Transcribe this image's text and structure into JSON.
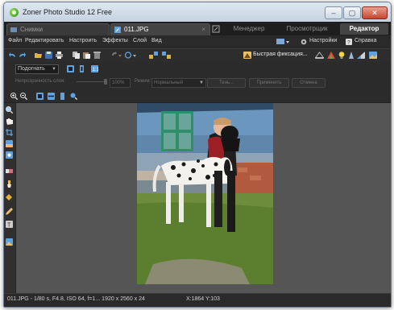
{
  "window": {
    "title": "Zoner Photo Studio 12 Free"
  },
  "tabs": {
    "browse_label": "Снимки",
    "doc_label": "011.JPG",
    "close_glyph": "×"
  },
  "modes": [
    "Менеджер",
    "Просмотрщик",
    "Редактор"
  ],
  "menu": {
    "items": [
      "Файл",
      "Редактировать",
      "Настроить",
      "Эффекты",
      "Слой",
      "Вид"
    ],
    "settings_label": "Настройки",
    "help_label": "Справка"
  },
  "toolbar": {
    "quick_fix_label": "Быстрая фиксация..."
  },
  "zoom": {
    "value": "Подогнать"
  },
  "layer_props": {
    "opacity_label": "Непрозрачность слоя:",
    "opacity_value": "100%",
    "mode_label": "Режим:",
    "mode_value": "Нормальный",
    "shadow_label": "Тень...",
    "apply_label": "Применить",
    "cancel_label": "Отмена"
  },
  "status": {
    "file_info": "011.JPG - 1/80 s, F4.8, ISO 64, f=1... 1920 x 2560 x 24",
    "coords": "X:1864 Y:103"
  },
  "colors": {
    "app_bg": "#2c2c2c",
    "canvas_bg": "#555555",
    "accent_active": "#444444"
  },
  "icons": {
    "window_controls": [
      "minimize-icon",
      "maximize-icon",
      "close-icon"
    ],
    "toolbar": [
      "undo-icon",
      "redo-icon",
      "open-folder-icon",
      "save-icon",
      "print-icon",
      "copy-icon",
      "paste-icon",
      "delete-icon"
    ],
    "left_tools": [
      "zoom-icon",
      "hand-icon",
      "crop-icon",
      "select-icon",
      "clone-icon",
      "eraser-icon",
      "brush-icon",
      "pencil-icon",
      "text-icon"
    ]
  }
}
